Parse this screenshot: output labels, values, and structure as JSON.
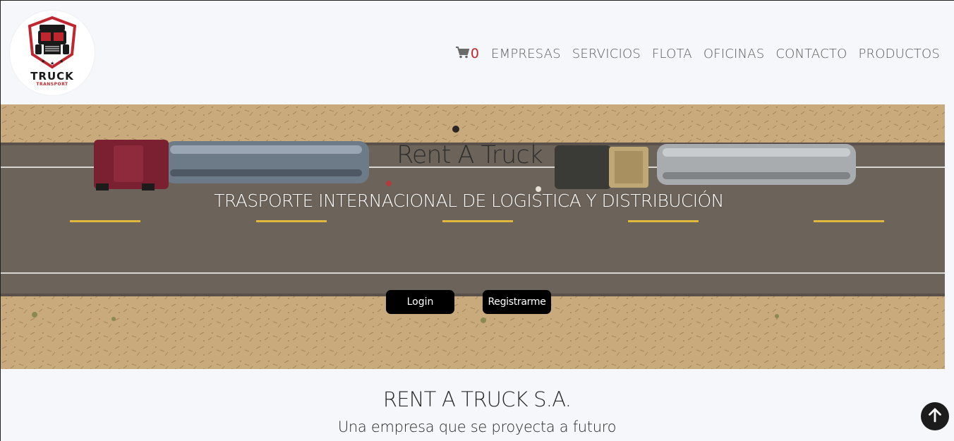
{
  "brand": {
    "logo_title": "TRUCK",
    "logo_subtitle": "TRANSPORT"
  },
  "nav": {
    "cart_count": "0",
    "items": [
      "EMPRESAS",
      "SERVICIOS",
      "FLOTA",
      "OFICINAS",
      "CONTACTO",
      "PRODUCTOS"
    ]
  },
  "hero": {
    "title": "Rent A Truck",
    "subtitle": "TRASPORTE INTERNACIONAL DE LOGISTICA Y DISTRIBUCIÓN",
    "login_label": "Login",
    "register_label": "Registrarme"
  },
  "company": {
    "title": "RENT A TRUCK S.A.",
    "tagline": "Una empresa que se proyecta a futuro"
  },
  "colors": {
    "accent": "#c0262d",
    "nav_text": "#5a5a5a",
    "button_bg": "#000000",
    "page_bg": "#f5f7fa"
  },
  "icons": {
    "cart": "cart-icon",
    "scroll_top": "arrow-up-icon"
  }
}
